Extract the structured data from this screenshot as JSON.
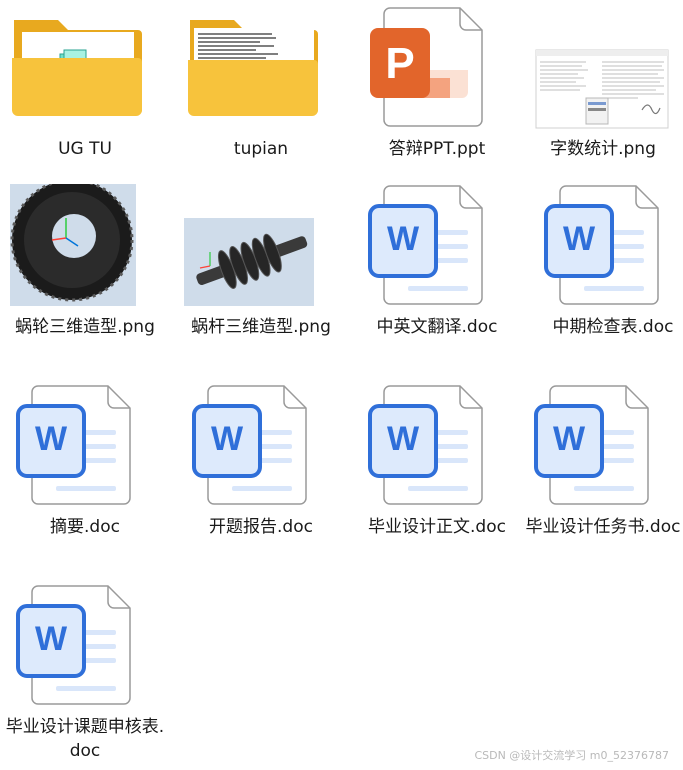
{
  "files": [
    {
      "name": "UG TU",
      "kind": "folder"
    },
    {
      "name": "tupian",
      "kind": "folder"
    },
    {
      "name": "答辩PPT.ppt",
      "kind": "ppt"
    },
    {
      "name": "字数统计.png",
      "kind": "image-document"
    },
    {
      "name": "蜗轮三维造型.png",
      "kind": "image-wheel"
    },
    {
      "name": "蜗杆三维造型.png",
      "kind": "image-worm"
    },
    {
      "name": "中英文翻译.doc",
      "kind": "word"
    },
    {
      "name": "中期检查表.doc",
      "kind": "word"
    },
    {
      "name": "摘要.doc",
      "kind": "word"
    },
    {
      "name": "开题报告.doc",
      "kind": "word"
    },
    {
      "name": "毕业设计正文.doc",
      "kind": "word"
    },
    {
      "name": "毕业设计任务书.doc",
      "kind": "word"
    },
    {
      "name": "毕业设计课题申核表.doc",
      "kind": "word"
    }
  ],
  "icons": {
    "word_letter": "W",
    "ppt_letter": "P"
  },
  "watermark": "CSDN @设计交流学习 m0_52376787",
  "colors": {
    "folder_yellow": "#f7c33c",
    "word_blue": "#2f6fd9",
    "ppt_orange": "#e2652b"
  }
}
